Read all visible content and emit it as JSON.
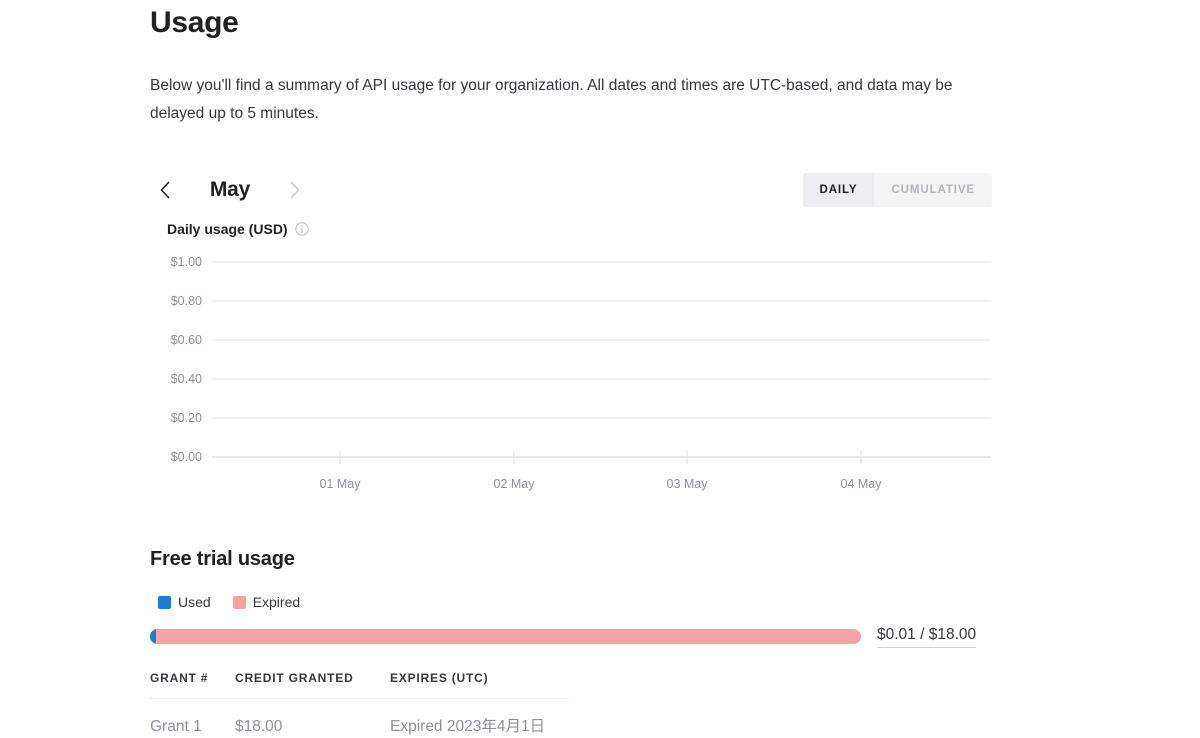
{
  "header": {
    "title": "Usage",
    "description": "Below you'll find a summary of API usage for your organization. All dates and times are UTC-based, and data may be delayed up to 5 minutes."
  },
  "toolbar": {
    "prev_label": "‹",
    "next_label": "›",
    "month": "May",
    "segments": [
      {
        "label": "DAILY",
        "selected": true
      },
      {
        "label": "CUMULATIVE",
        "selected": false
      }
    ]
  },
  "chart_caption": "Daily usage (USD)",
  "chart_info_icon": "info-icon",
  "chart_data": {
    "type": "bar",
    "title": "Daily usage (USD)",
    "xlabel": "",
    "ylabel": "",
    "categories": [
      "01 May",
      "02 May",
      "03 May",
      "04 May"
    ],
    "values": [
      0,
      0,
      0,
      0
    ],
    "ytick_labels": [
      "$1.00",
      "$0.80",
      "$0.60",
      "$0.40",
      "$0.20",
      "$0.00"
    ],
    "ytick_values": [
      1.0,
      0.8,
      0.6,
      0.4,
      0.2,
      0.0
    ],
    "ylim": [
      0,
      1.0
    ],
    "grid": true,
    "legend": "none"
  },
  "trial": {
    "title": "Free trial usage",
    "legend": [
      {
        "label": "Used",
        "color": "#1a7fd4"
      },
      {
        "label": "Expired",
        "color": "#f4a3a3"
      }
    ],
    "used_percent": 0.9,
    "amount": "$0.01 / $18.00",
    "table": {
      "headers": [
        "GRANT #",
        "CREDIT GRANTED",
        "EXPIRES (UTC)"
      ],
      "rows": [
        [
          "Grant 1",
          "$18.00",
          "Expired 2023年4月1日"
        ]
      ]
    }
  }
}
